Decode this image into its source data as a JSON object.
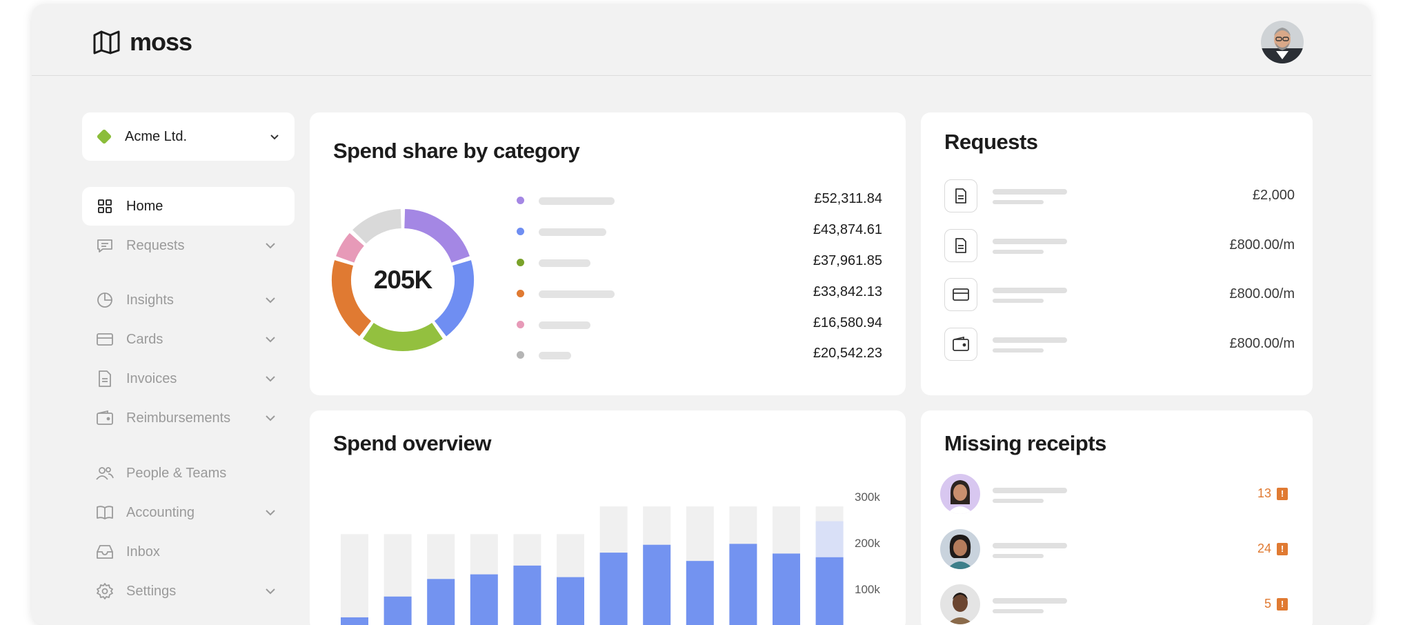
{
  "brand": {
    "name": "moss"
  },
  "company": {
    "name": "Acme Ltd.",
    "color": "#8bbd3a"
  },
  "nav": [
    {
      "label": "Home",
      "icon": "grid-icon",
      "active": true,
      "chevron": false
    },
    {
      "label": "Requests",
      "icon": "chat-icon",
      "chevron": true
    },
    {
      "label": "Insights",
      "icon": "pie-chart-icon",
      "chevron": true
    },
    {
      "label": "Cards",
      "icon": "credit-card-icon",
      "chevron": true
    },
    {
      "label": "Invoices",
      "icon": "document-icon",
      "chevron": true
    },
    {
      "label": "Reimbursements",
      "icon": "wallet-icon",
      "chevron": true
    },
    {
      "label": "People & Teams",
      "icon": "people-icon",
      "chevron": false
    },
    {
      "label": "Accounting",
      "icon": "book-icon",
      "chevron": true
    },
    {
      "label": "Inbox",
      "icon": "inbox-icon",
      "chevron": false
    },
    {
      "label": "Settings",
      "icon": "gear-icon",
      "chevron": true
    }
  ],
  "spend_share": {
    "title": "Spend share by category",
    "center_label": "205K",
    "items": [
      {
        "color": "#a487e4",
        "value": "£52,311.84"
      },
      {
        "color": "#6f8ef2",
        "value": "£43,874.61"
      },
      {
        "color": "#7aa22a",
        "value": "£37,961.85"
      },
      {
        "color": "#e07a32",
        "value": "£33,842.13"
      },
      {
        "color": "#e79ab8",
        "value": "£16,580.94"
      },
      {
        "color": "#b5b5b5",
        "value": "£20,542.23"
      }
    ],
    "donut_colors": [
      "#a487e4",
      "#6f8ef2",
      "#93c03f",
      "#e07a32",
      "#e79ab8",
      "#d9d9d9"
    ],
    "donut_shares": [
      0.2,
      0.2,
      0.2,
      0.2,
      0.07,
      0.13
    ]
  },
  "requests": {
    "title": "Requests",
    "items": [
      {
        "icon": "document-icon",
        "amount": "£2,000"
      },
      {
        "icon": "document-icon",
        "amount": "£800.00/m"
      },
      {
        "icon": "credit-card-icon",
        "amount": "£800.00/m"
      },
      {
        "icon": "wallet-icon",
        "amount": "£800.00/m"
      }
    ]
  },
  "spend_overview": {
    "title": "Spend overview",
    "y_ticks": [
      "300k",
      "200k",
      "100k"
    ]
  },
  "missing_receipts": {
    "title": "Missing receipts",
    "items": [
      {
        "count": "13",
        "flag": "!"
      },
      {
        "count": "24",
        "flag": "!"
      },
      {
        "count": "5",
        "flag": "!"
      }
    ]
  },
  "chart_data": {
    "type": "bar",
    "ylim": [
      0,
      300
    ],
    "series": [
      {
        "values": [
          30,
          75,
          113,
          123,
          142,
          117,
          170,
          187,
          152,
          189,
          168,
          160
        ]
      },
      {
        "values": [
          210,
          210,
          210,
          210,
          210,
          210,
          270,
          270,
          270,
          270,
          270,
          270
        ]
      }
    ],
    "projection": {
      "index": 11,
      "value": 238,
      "color": "#d9e0f7"
    },
    "colors": {
      "actual": "#7393f0",
      "target": "#f0f0f0"
    },
    "y_ticks": [
      300,
      200,
      100
    ]
  }
}
